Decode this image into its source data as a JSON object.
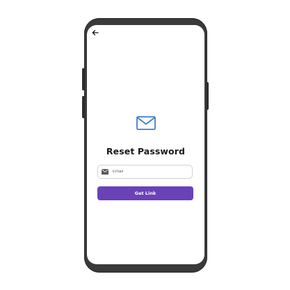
{
  "screen": {
    "back_icon": "arrow-left-icon",
    "mail_icon": "envelope-icon",
    "title": "Reset Password",
    "email_field": {
      "icon": "envelope-icon",
      "placeholder": "Email",
      "value": ""
    },
    "get_link_label": "Get Link"
  },
  "colors": {
    "accent": "#6a42b8",
    "mail_icon_stroke": "#3d7fd0",
    "mail_icon_fill": "#ffffff",
    "phone_frame": "#3a3a3a",
    "title_text": "#1a1a1a"
  }
}
